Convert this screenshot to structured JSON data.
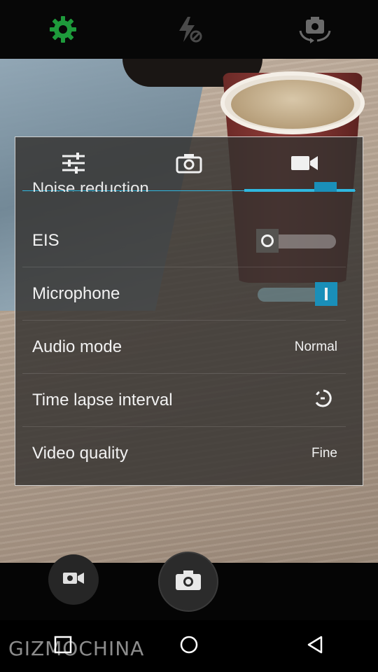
{
  "top_bar": {
    "icons": [
      "settings-gear-icon",
      "flash-off-icon",
      "switch-camera-icon"
    ],
    "active_color": "#1e9a3b"
  },
  "panel": {
    "tabs": [
      "general-settings-sliders-icon",
      "photo-camera-icon",
      "video-camera-icon"
    ],
    "active_tab": 2,
    "cutoff_label": "Noise reduction",
    "rows": [
      {
        "label": "EIS",
        "type": "toggle",
        "state": "off"
      },
      {
        "label": "Microphone",
        "type": "toggle",
        "state": "on"
      },
      {
        "label": "Audio mode",
        "type": "value",
        "value": "Normal"
      },
      {
        "label": "Time lapse interval",
        "type": "icon",
        "icon": "timer-icon"
      },
      {
        "label": "Video quality",
        "type": "value",
        "value": "Fine"
      }
    ],
    "accent_color": "#1a8fb9"
  },
  "bottom": {
    "video_mode_icon": "video-camera-icon",
    "shutter_icon": "camera-icon"
  },
  "nav": [
    "recent-apps-icon",
    "home-icon",
    "back-icon"
  ],
  "watermark": "GIZMOCHINA"
}
